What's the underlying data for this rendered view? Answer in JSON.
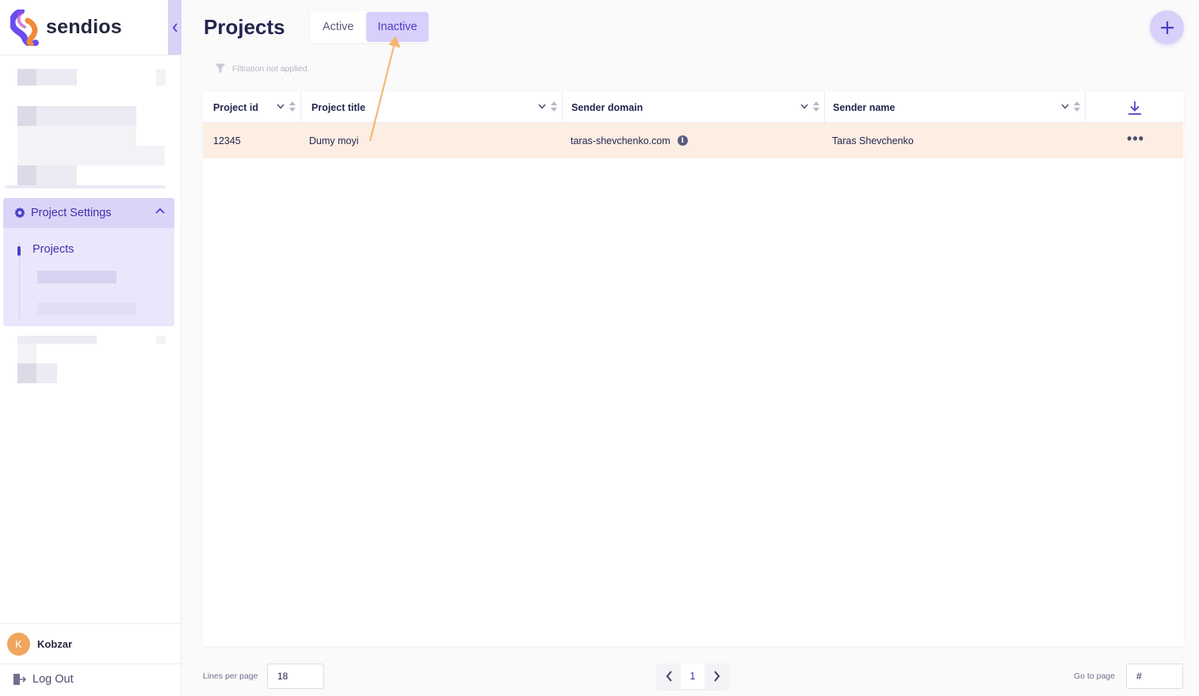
{
  "app": {
    "brand": "sendios",
    "accent": "#4a3fc5",
    "highlight_row": "#fdeee3"
  },
  "sidebar": {
    "settings_label": "Project Settings",
    "sub_item": "Projects",
    "user_initial": "K",
    "user_name": "Kobzar",
    "logout_label": "Log Out"
  },
  "header": {
    "title": "Projects",
    "tabs": [
      {
        "label": "Active",
        "selected": false
      },
      {
        "label": "Inactive",
        "selected": true
      }
    ]
  },
  "filter": {
    "note": "Filtration not applied."
  },
  "table": {
    "columns": [
      "Project id",
      "Project title",
      "Sender domain",
      "Sender name"
    ],
    "rows": [
      {
        "id": "12345",
        "title": "Dumy moyi",
        "domain": "taras-shevchenko.com",
        "sender": "Taras Shevchenko"
      }
    ],
    "info_glyph": "i",
    "more_glyph": "•••"
  },
  "footer": {
    "lines_per_page_label": "Lines per page",
    "lines_per_page_value": "18",
    "current_page": "1",
    "go_to_page_label": "Go to page",
    "go_to_page_placeholder": "#"
  },
  "icons": {
    "collapse": "chevron-left-icon",
    "settings": "gear-icon",
    "add": "plus-icon",
    "filter": "funnel-icon",
    "download": "download-icon",
    "logout": "logout-icon"
  }
}
